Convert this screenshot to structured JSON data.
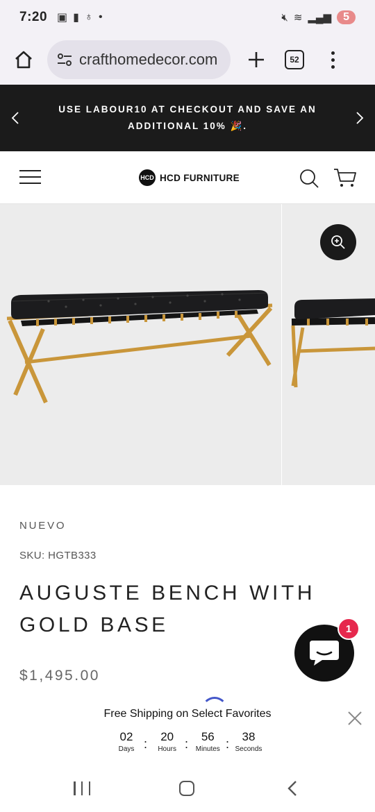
{
  "status_bar": {
    "time": "7:20",
    "battery": "5"
  },
  "browser": {
    "url": "crafthomedecor.com",
    "tab_count": "52"
  },
  "announcement": {
    "text": "USE LABOUR10 AT CHECKOUT AND SAVE AN ADDITIONAL 10% 🎉."
  },
  "store": {
    "logo_mark": "HCD",
    "logo_text": "HCD FURNITURE"
  },
  "product": {
    "vendor": "NUEVO",
    "sku": "SKU: HGTB333",
    "title": "AUGUSTE BENCH WITH GOLD BASE",
    "price": "$1,495.00"
  },
  "chat": {
    "badge": "1"
  },
  "countdown": {
    "title": "Free Shipping on Select Favorites",
    "units": [
      {
        "value": "02",
        "label": "Days"
      },
      {
        "value": "20",
        "label": "Hours"
      },
      {
        "value": "56",
        "label": "Minutes"
      },
      {
        "value": "38",
        "label": "Seconds"
      }
    ]
  },
  "colors": {
    "announce_bg": "#1b1b1b",
    "badge": "#e6284d",
    "gold": "#c9963a"
  }
}
